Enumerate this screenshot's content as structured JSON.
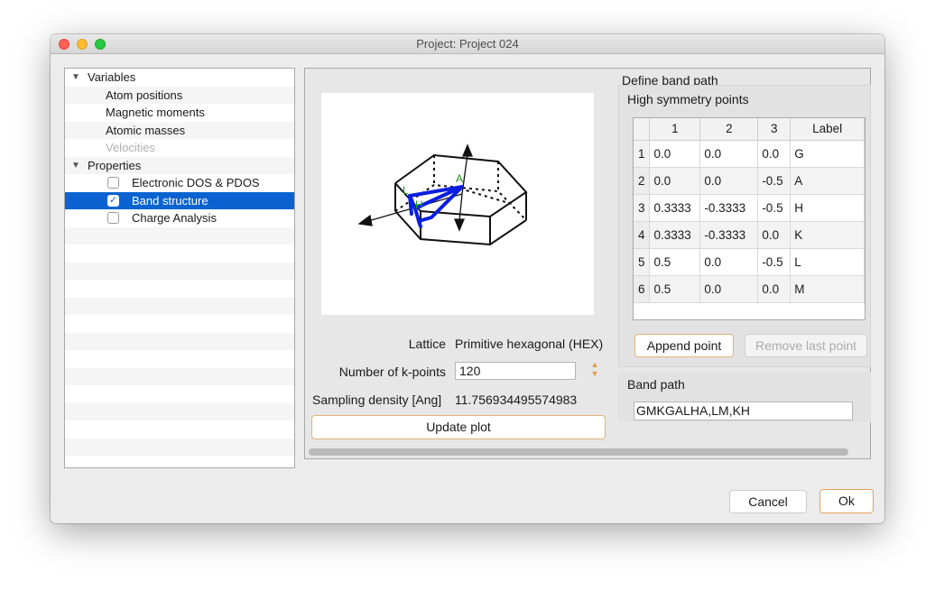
{
  "window": {
    "title": "Project: Project 024"
  },
  "tree": {
    "items": [
      {
        "label": "Variables",
        "type": "group"
      },
      {
        "label": "Atom positions",
        "type": "item"
      },
      {
        "label": "Magnetic moments",
        "type": "item"
      },
      {
        "label": "Atomic masses",
        "type": "item"
      },
      {
        "label": "Velocities",
        "type": "item",
        "disabled": true
      },
      {
        "label": "Properties",
        "type": "group"
      },
      {
        "label": "Electronic DOS & PDOS",
        "type": "check",
        "checked": false
      },
      {
        "label": "Band structure",
        "type": "check",
        "checked": true,
        "selected": true
      },
      {
        "label": "Charge Analysis",
        "type": "check",
        "checked": false
      }
    ]
  },
  "brillouin": {
    "point_labels": [
      "A",
      "L",
      "H"
    ],
    "label_color": "#1a9a1a",
    "path_color": "#0a1ee0"
  },
  "form": {
    "lattice_label": "Lattice",
    "lattice_value": "Primitive hexagonal (HEX)",
    "kpoints_label": "Number of k-points",
    "kpoints_value": "120",
    "sampling_label": "Sampling density [Ang]",
    "sampling_value": "11.756934495574983",
    "update_button": "Update plot"
  },
  "define": {
    "group_title": "Define band path",
    "hsp_title": "High symmetry points",
    "table": {
      "columns": [
        "1",
        "2",
        "3",
        "Label"
      ],
      "rows": [
        {
          "n": "1",
          "c1": "0.0",
          "c2": "0.0",
          "c3": "0.0",
          "label": "G"
        },
        {
          "n": "2",
          "c1": "0.0",
          "c2": "0.0",
          "c3": "-0.5",
          "label": "A"
        },
        {
          "n": "3",
          "c1": "0.3333",
          "c2": "-0.3333",
          "c3": "-0.5",
          "label": "H"
        },
        {
          "n": "4",
          "c1": "0.3333",
          "c2": "-0.3333",
          "c3": "0.0",
          "label": "K"
        },
        {
          "n": "5",
          "c1": "0.5",
          "c2": "0.0",
          "c3": "-0.5",
          "label": "L"
        },
        {
          "n": "6",
          "c1": "0.5",
          "c2": "0.0",
          "c3": "0.0",
          "label": "M"
        }
      ]
    },
    "append_button": "Append point",
    "remove_button": "Remove last point",
    "band_path_title": "Band path",
    "band_path_value": "GMKGALHA,LM,KH"
  },
  "dialog": {
    "cancel": "Cancel",
    "ok": "Ok"
  },
  "colors": {
    "accent": "#0a63d1",
    "button_focus_border": "#e0b27b"
  }
}
